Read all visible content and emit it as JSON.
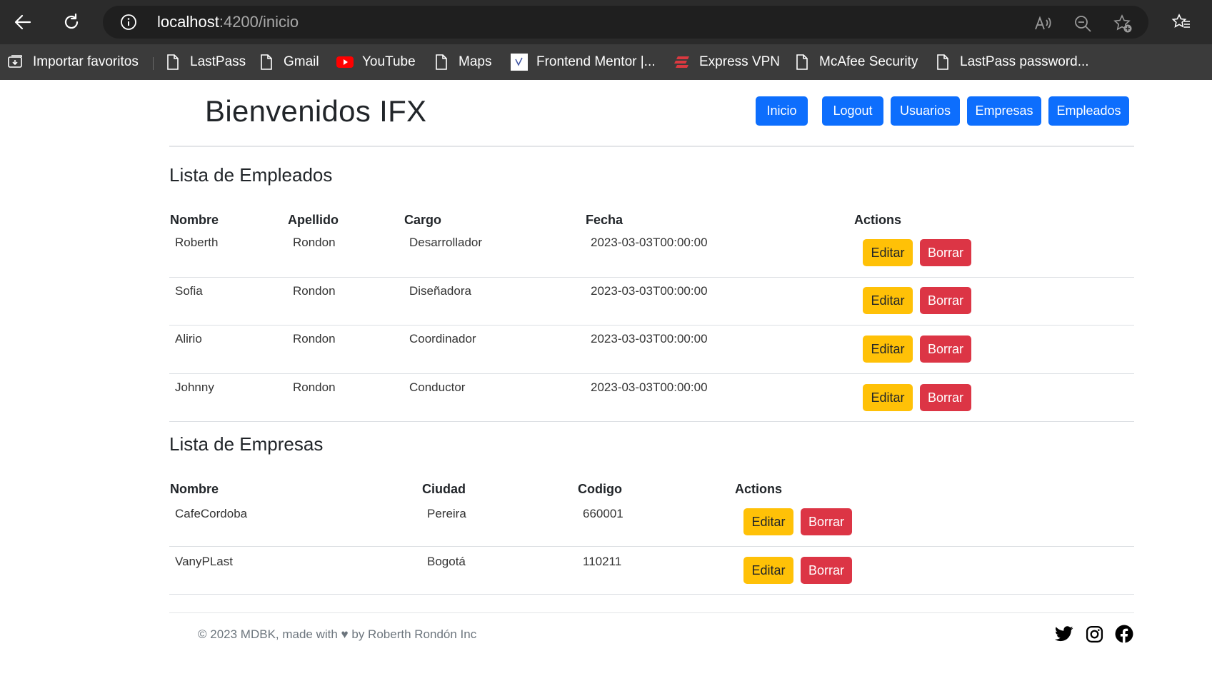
{
  "browser": {
    "url_host": "localhost",
    "url_path": ":4200/inicio",
    "bookmarks": [
      {
        "label": "Importar favoritos",
        "icon": "import-icon"
      },
      {
        "label": "LastPass",
        "icon": "page-icon"
      },
      {
        "label": "Gmail",
        "icon": "page-icon"
      },
      {
        "label": "YouTube",
        "icon": "youtube-icon"
      },
      {
        "label": "Maps",
        "icon": "page-icon"
      },
      {
        "label": "Frontend Mentor |...",
        "icon": "frontend-mentor-icon"
      },
      {
        "label": "Express VPN",
        "icon": "expressvpn-icon"
      },
      {
        "label": "McAfee Security",
        "icon": "page-icon"
      },
      {
        "label": "LastPass password...",
        "icon": "page-icon"
      }
    ]
  },
  "header": {
    "title": "Bienvenidos IFX",
    "nav": [
      "Inicio",
      "Logout",
      "Usuarios",
      "Empresas",
      "Empleados"
    ]
  },
  "employees": {
    "title": "Lista de Empleados",
    "columns": [
      "Nombre",
      "Apellido",
      "Cargo",
      "Fecha",
      "Actions"
    ],
    "rows": [
      [
        "Roberth",
        "Rondon",
        "Desarrollador",
        "2023-03-03T00:00:00"
      ],
      [
        "Sofia",
        "Rondon",
        "Diseñadora",
        "2023-03-03T00:00:00"
      ],
      [
        "Alirio",
        "Rondon",
        "Coordinador",
        "2023-03-03T00:00:00"
      ],
      [
        "Johnny",
        "Rondon",
        "Conductor",
        "2023-03-03T00:00:00"
      ]
    ]
  },
  "companies": {
    "title": "Lista de Empresas",
    "columns": [
      "Nombre",
      "Ciudad",
      "Codigo",
      "Actions"
    ],
    "rows": [
      [
        "CafeCordoba",
        "Pereira",
        "660001"
      ],
      [
        "VanyPLast",
        "Bogotá",
        "110211"
      ]
    ]
  },
  "actions": {
    "edit": "Editar",
    "delete": "Borrar"
  },
  "footer": {
    "text": "© 2023 MDBK, made with ♥ by Roberth Rondón Inc",
    "social": [
      "twitter-icon",
      "instagram-icon",
      "facebook-icon"
    ]
  },
  "colors": {
    "primary": "#0d6efd",
    "warning": "#ffc107",
    "danger": "#dc3545"
  }
}
